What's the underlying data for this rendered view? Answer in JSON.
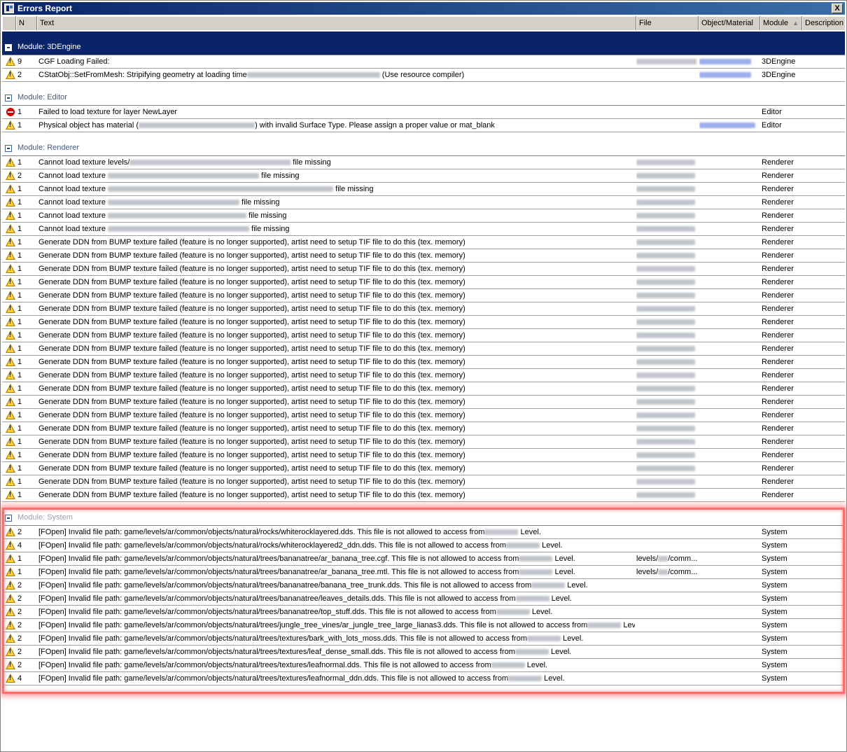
{
  "window": {
    "title": "Errors Report",
    "close_label": "X"
  },
  "columns": {
    "n": "N",
    "text": "Text",
    "file": "File",
    "object": "Object/Material",
    "module": "Module",
    "description": "Description"
  },
  "groups": [
    {
      "label": "Module: 3DEngine",
      "selected": true,
      "rows": [
        {
          "icon": "warning-icon",
          "n": "9",
          "text": "CGF Loading Failed:",
          "file": "",
          "object": "",
          "module": "3DEngine",
          "fileBlur": 86,
          "objBlur": 74
        },
        {
          "icon": "warning-icon",
          "n": "2",
          "text": "CStatObj::SetFromMesh: Stripifying geometry at loading time",
          "textBlur": 190,
          "suffix": " (Use resource compiler)",
          "file": "",
          "object": "",
          "module": "3DEngine",
          "objBlur": 74
        }
      ]
    },
    {
      "label": "Module: Editor",
      "rows": [
        {
          "icon": "error-icon",
          "n": "1",
          "text": "Failed to load texture for layer NewLayer",
          "file": "",
          "object": "",
          "module": "Editor"
        },
        {
          "icon": "warning-icon",
          "n": "1",
          "text": "Physical object has material (",
          "textBlur": 166,
          "suffix": ") with invalid Surface Type. Please assign a proper value or mat_blank",
          "file": "",
          "object": "",
          "module": "Editor",
          "objBlur": 80
        }
      ]
    },
    {
      "label": "Module: Renderer",
      "rows": [
        {
          "icon": "warning-icon",
          "n": "1",
          "text": "Cannot load texture levels/",
          "textBlur": 230,
          "suffix": " file missing",
          "module": "Renderer",
          "fileBlur": 84
        },
        {
          "icon": "warning-icon",
          "n": "2",
          "text": "Cannot load texture ",
          "textBlur": 216,
          "suffix": " file missing",
          "module": "Renderer",
          "fileBlur": 84
        },
        {
          "icon": "warning-icon",
          "n": "1",
          "text": "Cannot load texture ",
          "textBlur": 322,
          "suffix": " file missing",
          "module": "Renderer",
          "fileBlur": 84
        },
        {
          "icon": "warning-icon",
          "n": "1",
          "text": "Cannot load texture ",
          "textBlur": 188,
          "suffix": " file missing",
          "module": "Renderer",
          "fileBlur": 84
        },
        {
          "icon": "warning-icon",
          "n": "1",
          "text": "Cannot load texture ",
          "textBlur": 198,
          "suffix": " file missing",
          "module": "Renderer",
          "fileBlur": 84
        },
        {
          "icon": "warning-icon",
          "n": "1",
          "text": "Cannot load texture ",
          "textBlur": 202,
          "suffix": " file missing",
          "module": "Renderer",
          "fileBlur": 84
        },
        {
          "icon": "warning-icon",
          "n": "1",
          "text": "Generate DDN from BUMP texture failed (feature is no longer supported), artist need to setup TIF file to do this (tex. memory)",
          "module": "Renderer",
          "fileBlur": 84
        },
        {
          "icon": "warning-icon",
          "n": "1",
          "text": "Generate DDN from BUMP texture failed (feature is no longer supported), artist need to setup TIF file to do this (tex. memory)",
          "module": "Renderer",
          "fileBlur": 84
        },
        {
          "icon": "warning-icon",
          "n": "1",
          "text": "Generate DDN from BUMP texture failed (feature is no longer supported), artist need to setup TIF file to do this (tex. memory)",
          "module": "Renderer",
          "fileBlur": 84
        },
        {
          "icon": "warning-icon",
          "n": "1",
          "text": "Generate DDN from BUMP texture failed (feature is no longer supported), artist need to setup TIF file to do this (tex. memory)",
          "module": "Renderer",
          "fileBlur": 84
        },
        {
          "icon": "warning-icon",
          "n": "1",
          "text": "Generate DDN from BUMP texture failed (feature is no longer supported), artist need to setup TIF file to do this (tex. memory)",
          "module": "Renderer",
          "fileBlur": 84
        },
        {
          "icon": "warning-icon",
          "n": "1",
          "text": "Generate DDN from BUMP texture failed (feature is no longer supported), artist need to setup TIF file to do this (tex. memory)",
          "module": "Renderer",
          "fileBlur": 84
        },
        {
          "icon": "warning-icon",
          "n": "1",
          "text": "Generate DDN from BUMP texture failed (feature is no longer supported), artist need to setup TIF file to do this (tex. memory)",
          "module": "Renderer",
          "fileBlur": 84
        },
        {
          "icon": "warning-icon",
          "n": "1",
          "text": "Generate DDN from BUMP texture failed (feature is no longer supported), artist need to setup TIF file to do this (tex. memory)",
          "module": "Renderer",
          "fileBlur": 84
        },
        {
          "icon": "warning-icon",
          "n": "1",
          "text": "Generate DDN from BUMP texture failed (feature is no longer supported), artist need to setup TIF file to do this (tex. memory)",
          "module": "Renderer",
          "fileBlur": 84
        },
        {
          "icon": "warning-icon",
          "n": "1",
          "text": "Generate DDN from BUMP texture failed (feature is no longer supported), artist need to setup TIF file to do this (tex. memory)",
          "module": "Renderer",
          "fileBlur": 84
        },
        {
          "icon": "warning-icon",
          "n": "1",
          "text": "Generate DDN from BUMP texture failed (feature is no longer supported), artist need to setup TIF file to do this (tex. memory)",
          "module": "Renderer",
          "fileBlur": 84
        },
        {
          "icon": "warning-icon",
          "n": "1",
          "text": "Generate DDN from BUMP texture failed (feature is no longer supported), artist need to setup TIF file to do this (tex. memory)",
          "module": "Renderer",
          "fileBlur": 84
        },
        {
          "icon": "warning-icon",
          "n": "1",
          "text": "Generate DDN from BUMP texture failed (feature is no longer supported), artist need to setup TIF file to do this (tex. memory)",
          "module": "Renderer",
          "fileBlur": 84
        },
        {
          "icon": "warning-icon",
          "n": "1",
          "text": "Generate DDN from BUMP texture failed (feature is no longer supported), artist need to setup TIF file to do this (tex. memory)",
          "module": "Renderer",
          "fileBlur": 84
        },
        {
          "icon": "warning-icon",
          "n": "1",
          "text": "Generate DDN from BUMP texture failed (feature is no longer supported), artist need to setup TIF file to do this (tex. memory)",
          "module": "Renderer",
          "fileBlur": 84
        },
        {
          "icon": "warning-icon",
          "n": "1",
          "text": "Generate DDN from BUMP texture failed (feature is no longer supported), artist need to setup TIF file to do this (tex. memory)",
          "module": "Renderer",
          "fileBlur": 84
        },
        {
          "icon": "warning-icon",
          "n": "1",
          "text": "Generate DDN from BUMP texture failed (feature is no longer supported), artist need to setup TIF file to do this (tex. memory)",
          "module": "Renderer",
          "fileBlur": 84
        },
        {
          "icon": "warning-icon",
          "n": "1",
          "text": "Generate DDN from BUMP texture failed (feature is no longer supported), artist need to setup TIF file to do this (tex. memory)",
          "module": "Renderer",
          "fileBlur": 84
        },
        {
          "icon": "warning-icon",
          "n": "1",
          "text": "Generate DDN from BUMP texture failed (feature is no longer supported), artist need to setup TIF file to do this (tex. memory)",
          "module": "Renderer",
          "fileBlur": 84
        },
        {
          "icon": "warning-icon",
          "n": "1",
          "text": "Generate DDN from BUMP texture failed (feature is no longer supported), artist need to setup TIF file to do this (tex. memory)",
          "module": "Renderer",
          "fileBlur": 84
        }
      ]
    },
    {
      "label": "Module: System",
      "faded": true,
      "rows": [
        {
          "icon": "warning-icon",
          "n": "2",
          "text": "[FOpen] Invalid file path: game/levels/ar/common/objects/natural/rocks/whiterocklayered.dds. This file is not allowed to access from",
          "textBlur": 48,
          "suffix": " Level.",
          "module": "System"
        },
        {
          "icon": "warning-icon",
          "n": "4",
          "text": "[FOpen] Invalid file path: game/levels/ar/common/objects/natural/rocks/whiterocklayered2_ddn.dds. This file is not allowed to access from",
          "textBlur": 48,
          "suffix": " Level.",
          "module": "System"
        },
        {
          "icon": "warning-icon",
          "n": "1",
          "text": "[FOpen] Invalid file path: game/levels/ar/common/objects/natural/trees/bananatree/ar_banana_tree.cgf. This file is not allowed to access from",
          "textBlur": 48,
          "suffix": " Level.",
          "file": "levels/",
          "fileSuffix": "/comm...",
          "module": "System",
          "fileBlur": 14
        },
        {
          "icon": "warning-icon",
          "n": "1",
          "text": "[FOpen] Invalid file path: game/levels/ar/common/objects/natural/trees/bananatree/ar_banana_tree.mtl. This file is not allowed to access from",
          "textBlur": 48,
          "suffix": " Level.",
          "file": "levels/",
          "fileSuffix": "/comm...",
          "module": "System",
          "fileBlur": 14
        },
        {
          "icon": "warning-icon",
          "n": "2",
          "text": "[FOpen] Invalid file path: game/levels/ar/common/objects/natural/trees/bananatree/banana_tree_trunk.dds. This file is not allowed to access from",
          "textBlur": 48,
          "suffix": " Level.",
          "module": "System"
        },
        {
          "icon": "warning-icon",
          "n": "2",
          "text": "[FOpen] Invalid file path: game/levels/ar/common/objects/natural/trees/bananatree/leaves_details.dds. This file is not allowed to access from",
          "textBlur": 48,
          "suffix": " Level.",
          "module": "System"
        },
        {
          "icon": "warning-icon",
          "n": "2",
          "text": "[FOpen] Invalid file path: game/levels/ar/common/objects/natural/trees/bananatree/top_stuff.dds. This file is not allowed to access from",
          "textBlur": 48,
          "suffix": " Level.",
          "module": "System"
        },
        {
          "icon": "warning-icon",
          "n": "2",
          "text": "[FOpen] Invalid file path: game/levels/ar/common/objects/natural/trees/jungle_tree_vines/ar_jungle_tree_large_lianas3.dds. This file is not allowed to access from",
          "textBlur": 48,
          "suffix": " Level.",
          "module": "System"
        },
        {
          "icon": "warning-icon",
          "n": "2",
          "text": "[FOpen] Invalid file path: game/levels/ar/common/objects/natural/trees/textures/bark_with_lots_moss.dds. This file is not allowed to access from",
          "textBlur": 48,
          "suffix": " Level.",
          "module": "System"
        },
        {
          "icon": "warning-icon",
          "n": "2",
          "text": "[FOpen] Invalid file path: game/levels/ar/common/objects/natural/trees/textures/leaf_dense_small.dds. This file is not allowed to access from",
          "textBlur": 48,
          "suffix": " Level.",
          "module": "System"
        },
        {
          "icon": "warning-icon",
          "n": "2",
          "text": "[FOpen] Invalid file path: game/levels/ar/common/objects/natural/trees/textures/leafnormal.dds. This file is not allowed to access from",
          "textBlur": 48,
          "suffix": " Level.",
          "module": "System"
        },
        {
          "icon": "warning-icon",
          "n": "4",
          "text": "[FOpen] Invalid file path: game/levels/ar/common/objects/natural/trees/textures/leafnormal_ddn.dds. This file is not allowed to access from",
          "textBlur": 48,
          "suffix": " Level.",
          "module": "System"
        }
      ]
    }
  ]
}
